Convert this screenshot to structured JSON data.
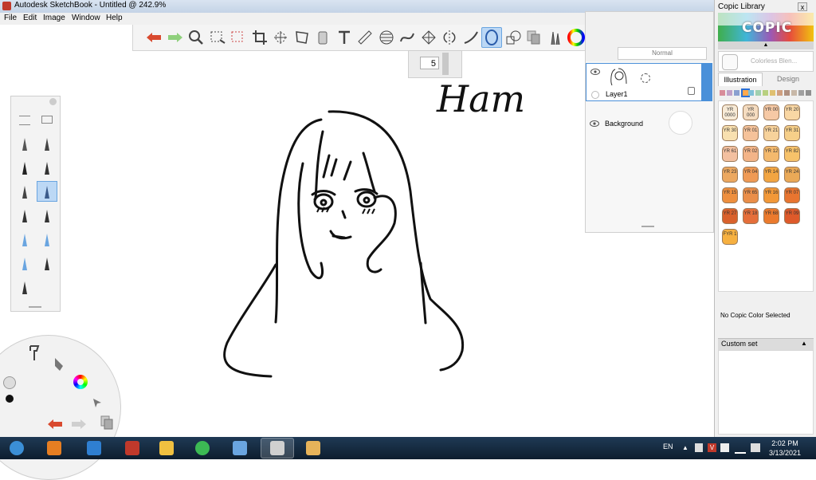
{
  "window": {
    "title": "Autodesk SketchBook - Untitled @ 242.9%"
  },
  "menu": [
    "File",
    "Edit",
    "Image",
    "Window",
    "Help"
  ],
  "toolbar": {
    "tools": [
      {
        "name": "undo",
        "icon": "undo-arrow-icon"
      },
      {
        "name": "redo",
        "icon": "redo-arrow-icon"
      },
      {
        "name": "zoom",
        "icon": "magnifier-icon"
      },
      {
        "name": "select",
        "icon": "rect-select-icon"
      },
      {
        "name": "select-add",
        "icon": "rect-select-plus-icon"
      },
      {
        "name": "crop",
        "icon": "crop-icon"
      },
      {
        "name": "transform",
        "icon": "move-icon"
      },
      {
        "name": "distort",
        "icon": "distort-icon"
      },
      {
        "name": "fill",
        "icon": "bucket-icon"
      },
      {
        "name": "text",
        "icon": "text-icon"
      },
      {
        "name": "ruler",
        "icon": "ruler-icon"
      },
      {
        "name": "ellipse",
        "icon": "ellipse-guide-icon"
      },
      {
        "name": "french-curve",
        "icon": "curve-icon"
      },
      {
        "name": "perspective",
        "icon": "perspective-icon"
      },
      {
        "name": "symmetry",
        "icon": "symmetry-icon"
      },
      {
        "name": "stroke",
        "icon": "stroke-icon"
      },
      {
        "name": "ellipse-tool",
        "icon": "ellipse-icon"
      },
      {
        "name": "shapes",
        "icon": "shapes-icon"
      },
      {
        "name": "copy",
        "icon": "copy-layer-icon"
      },
      {
        "name": "brushes",
        "icon": "brushes-icon"
      },
      {
        "name": "color",
        "icon": "color-wheel-icon"
      },
      {
        "name": "palette",
        "icon": "palette-grid-icon"
      }
    ],
    "selected_tool": "ellipse-tool",
    "brush_size": "5"
  },
  "layers": {
    "mode": "Normal",
    "items": [
      {
        "name": "Layer1",
        "visible": true,
        "selected": true
      },
      {
        "name": "Background",
        "visible": true,
        "selected": false
      }
    ]
  },
  "copic": {
    "title": "Copic Library",
    "logo_text": "COPIC",
    "colorless_label": "Colorless Blen...",
    "tabs": [
      "Illustration",
      "Design"
    ],
    "active_tab": "Illustration",
    "family_colors": [
      "#d88c9a",
      "#c0a0c8",
      "#8aa0d0",
      "#ffa94d",
      "#7fc0d8",
      "#a0d0b0",
      "#b8d080",
      "#e0c070",
      "#d0a080",
      "#b09080",
      "#c8b8a8",
      "#a0a0a0",
      "#909090"
    ],
    "swatches": [
      {
        "code": "YR 0000",
        "color": "#f7ead6"
      },
      {
        "code": "YR 000",
        "color": "#f5dcc0"
      },
      {
        "code": "YR 00",
        "color": "#f6c9a5"
      },
      {
        "code": "YR 20",
        "color": "#f9d7a4"
      },
      {
        "code": "YR 30",
        "color": "#f8e0b0"
      },
      {
        "code": "YR 01",
        "color": "#f5c29a"
      },
      {
        "code": "YR 21",
        "color": "#f7d29b"
      },
      {
        "code": "YR 31",
        "color": "#f6cf89"
      },
      {
        "code": "YR 61",
        "color": "#f3c0a0"
      },
      {
        "code": "YR 02",
        "color": "#f3b488"
      },
      {
        "code": "YR 12",
        "color": "#f4b96d"
      },
      {
        "code": "YR 82",
        "color": "#f7c26a"
      },
      {
        "code": "YR 23",
        "color": "#eca860"
      },
      {
        "code": "YR 04",
        "color": "#ef9a55"
      },
      {
        "code": "YR 14",
        "color": "#f2a542"
      },
      {
        "code": "YR 24",
        "color": "#eaa957"
      },
      {
        "code": "YR 15",
        "color": "#ee8f3e"
      },
      {
        "code": "YR 65",
        "color": "#ea8e49"
      },
      {
        "code": "YR 16",
        "color": "#f29838"
      },
      {
        "code": "YR 07",
        "color": "#e87530"
      },
      {
        "code": "YR 27",
        "color": "#d9612c"
      },
      {
        "code": "YR 18",
        "color": "#e56e3a"
      },
      {
        "code": "YR 68",
        "color": "#eb7a2d"
      },
      {
        "code": "YR 09",
        "color": "#de5a2a"
      },
      {
        "code": "FYR 1",
        "color": "#f6b040"
      }
    ],
    "no_selection": "No Copic Color Selected",
    "custom_set": "Custom set"
  },
  "canvas": {
    "handwriting": "Ham"
  },
  "taskbar": {
    "apps": [
      "start",
      "media-player",
      "internet-explorer",
      "paint-tools",
      "file-explorer",
      "chrome",
      "picture-viewer",
      "sketchbook",
      "paint"
    ],
    "active_app": "sketchbook",
    "language": "EN",
    "time": "2:02 PM",
    "date": "3/13/2021"
  }
}
